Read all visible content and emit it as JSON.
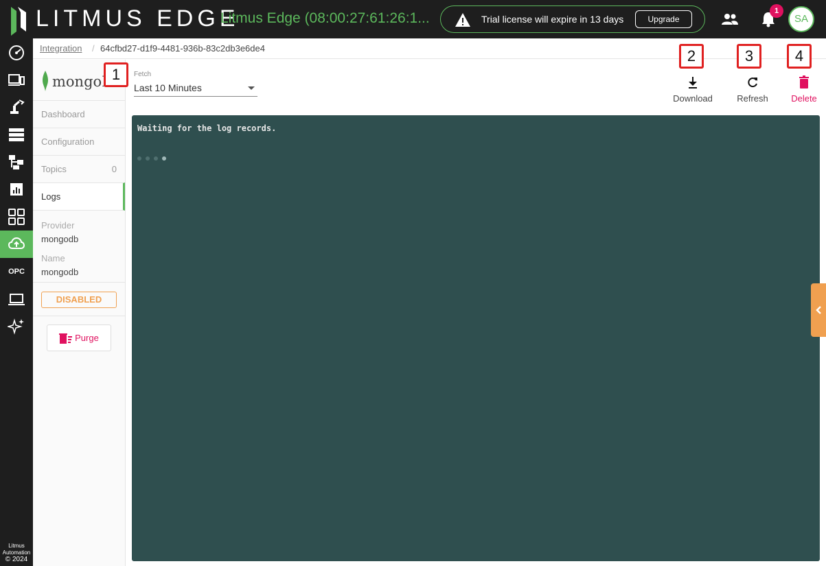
{
  "header": {
    "brand": "LITMUS EDGE",
    "device_title": "Litmus Edge (08:00:27:61:26:1...",
    "trial_message": "Trial license will expire in 13 days",
    "upgrade_label": "Upgrade",
    "notification_count": "1",
    "avatar_initials": "SA"
  },
  "nav": {
    "items": [
      "dashboard-icon",
      "devices-icon",
      "robot-arm-icon",
      "storage-icon",
      "flows-icon",
      "analytics-icon",
      "apps-grid-icon",
      "cloud-upload-icon",
      "opc-icon",
      "computer-icon",
      "sparkle-icon"
    ],
    "opc_label": "OPC",
    "copyright_company": "Litmus Automation",
    "copyright_year": "© 2024"
  },
  "breadcrumb": {
    "parent": "Integration",
    "separator": "/",
    "current": "64cfbd27-d1f9-4481-936b-83c2db3e6de4"
  },
  "sidebar": {
    "provider_logo_text": "mongoDB",
    "menu": [
      {
        "label": "Dashboard"
      },
      {
        "label": "Configuration"
      },
      {
        "label": "Topics",
        "count": "0"
      },
      {
        "label": "Logs"
      }
    ],
    "provider_label": "Provider",
    "provider_value": "mongodb",
    "name_label": "Name",
    "name_value": "mongodb",
    "status": "DISABLED",
    "purge_label": "Purge"
  },
  "fetch": {
    "label": "Fetch",
    "value": "Last 10 Minutes"
  },
  "actions": {
    "download": "Download",
    "refresh": "Refresh",
    "delete": "Delete"
  },
  "callouts": [
    "1",
    "2",
    "3",
    "4"
  ],
  "log": {
    "message": "Waiting for the log records."
  },
  "colors": {
    "accent": "#5cb85c",
    "danger": "#e0115f",
    "warning": "#f0a050",
    "log_bg": "#2f4f4f"
  }
}
